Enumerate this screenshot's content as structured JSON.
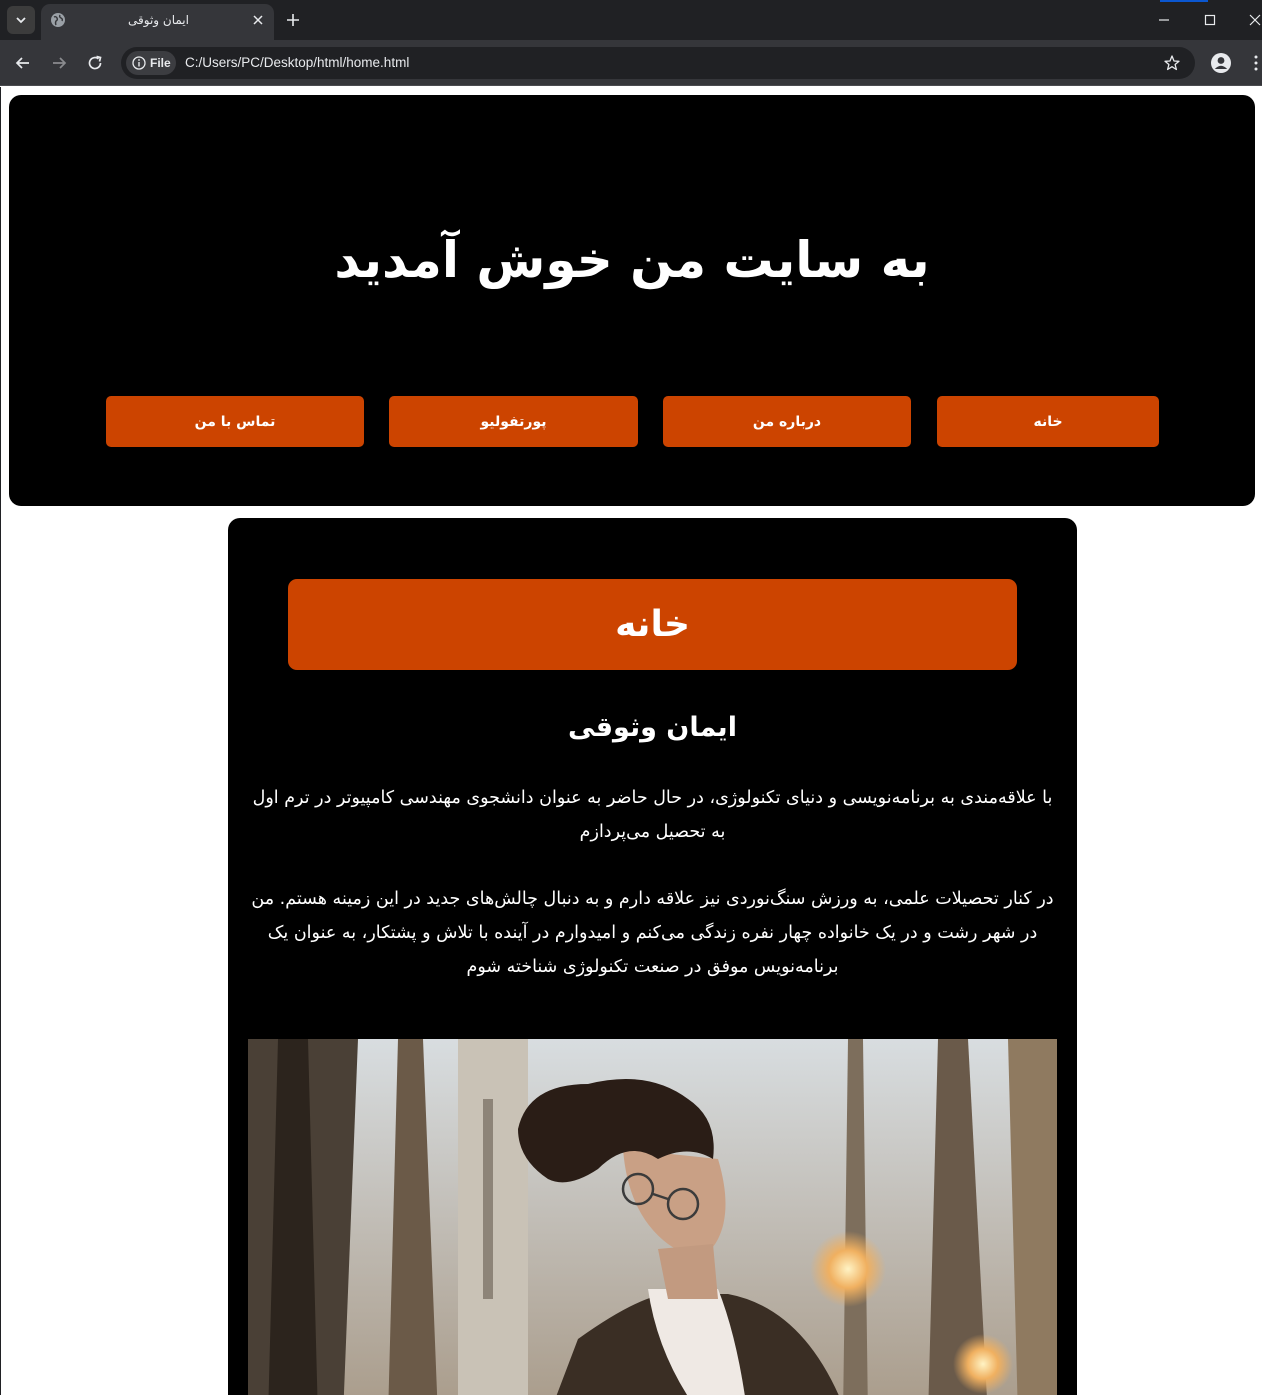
{
  "browser": {
    "tab_title": "ایمان وثوقی",
    "site_chip_label": "File",
    "url": "C:/Users/PC/Desktop/html/home.html"
  },
  "page": {
    "hero_title": "به سایت من خوش آمدید",
    "nav": {
      "home": "خانه",
      "about": "درباره من",
      "portfolio": "پورتفولیو",
      "contact": "تماس با من"
    },
    "section_title": "خانه",
    "person_name": "ایمان وثوقی",
    "bio_paragraph_1": "با علاقه‌مندی به برنامه‌نویسی و دنیای تکنولوژی، در حال حاضر به عنوان دانشجوی مهندسی کامپیوتر در ترم اول به تحصیل می‌پردازم",
    "bio_paragraph_2": "در کنار تحصیلات علمی، به ورزش سنگ‌نوردی نیز علاقه دارم و به دنبال چالش‌های جدید در این زمینه هستم. من در شهر رشت و در یک خانواده چهار نفره زندگی می‌کنم و امیدوارم در آینده با تلاش و پشتکار، به عنوان یک برنامه‌نویس موفق در صنعت تکنولوژی شناخته شوم"
  },
  "colors": {
    "accent": "#cc4400",
    "panel": "#000000",
    "chrome_dark": "#202124",
    "chrome_mid": "#35363a"
  },
  "icons": [
    "tab-list-icon",
    "globe-icon",
    "close-icon",
    "plus-icon",
    "minimize-icon",
    "maximize-icon",
    "window-close-icon",
    "back-arrow-icon",
    "forward-arrow-icon",
    "reload-icon",
    "info-icon",
    "star-icon",
    "profile-icon",
    "kebab-menu-icon"
  ]
}
